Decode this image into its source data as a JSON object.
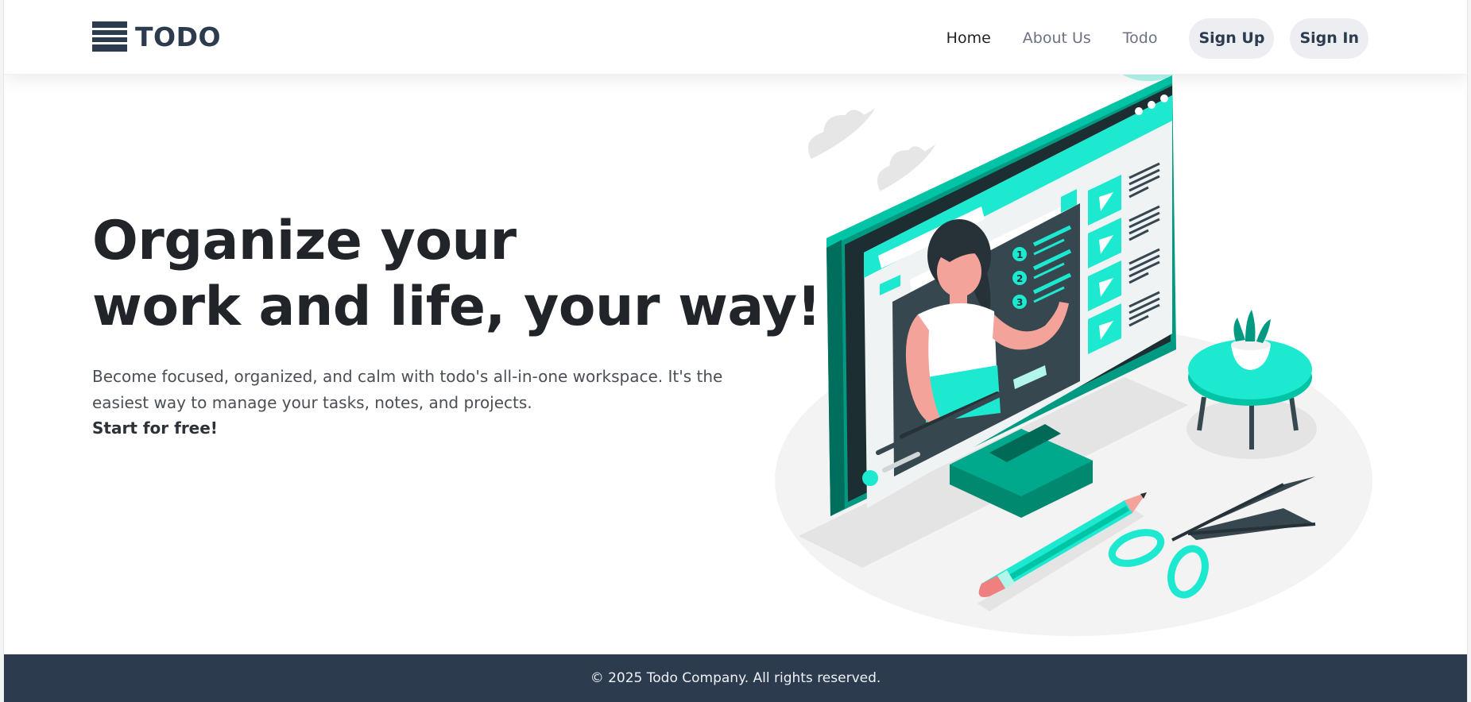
{
  "brand": {
    "name": "TODO",
    "icon": "list-logo-icon"
  },
  "nav": {
    "home": "Home",
    "about": "About Us",
    "todo": "Todo",
    "sign_up": "Sign Up",
    "sign_in": "Sign In"
  },
  "hero": {
    "title_line1": "Organize your",
    "title_line2": "work and life, your way!",
    "description": "Become focused, organized, and calm with todo's all-in-one workspace. It's the easiest way to manage your tasks, notes, and projects.",
    "cta": "Start for free!"
  },
  "illustration": {
    "icon": "online-video-lesson-illustration",
    "accent": "#1de9d0",
    "accent_dark": "#009a82",
    "ink": "#263238"
  },
  "footer": {
    "copyright": "© 2025 Todo Company. All rights reserved."
  }
}
